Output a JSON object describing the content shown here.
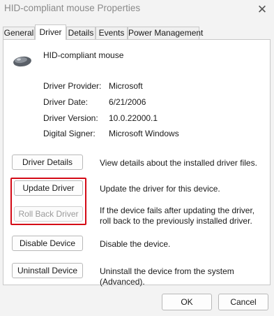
{
  "window": {
    "title": "HID-compliant mouse Properties",
    "close_glyph": "✕"
  },
  "tabs": [
    {
      "label": "General"
    },
    {
      "label": "Driver"
    },
    {
      "label": "Details"
    },
    {
      "label": "Events"
    },
    {
      "label": "Power Management"
    }
  ],
  "active_tab": "Driver",
  "device": {
    "icon": "mouse-icon",
    "name": "HID-compliant mouse"
  },
  "driver_info": [
    {
      "label": "Driver Provider:",
      "value": "Microsoft"
    },
    {
      "label": "Driver Date:",
      "value": "6/21/2006"
    },
    {
      "label": "Driver Version:",
      "value": "10.0.22000.1"
    },
    {
      "label": "Digital Signer:",
      "value": "Microsoft Windows"
    }
  ],
  "actions": [
    {
      "label": "Driver Details",
      "description": "View details about the installed driver files.",
      "enabled": true
    },
    {
      "label": "Update Driver",
      "description": "Update the driver for this device.",
      "enabled": true
    },
    {
      "label": "Roll Back Driver",
      "description": "If the device fails after updating the driver, roll back to the previously installed driver.",
      "enabled": false
    },
    {
      "label": "Disable Device",
      "description": "Disable the device.",
      "enabled": true
    },
    {
      "label": "Uninstall Device",
      "description": "Uninstall the device from the system (Advanced).",
      "enabled": true
    }
  ],
  "footer": {
    "ok_label": "OK",
    "cancel_label": "Cancel"
  },
  "colors": {
    "highlight": "#d40a16",
    "disabled_text": "#9a9a9a"
  }
}
